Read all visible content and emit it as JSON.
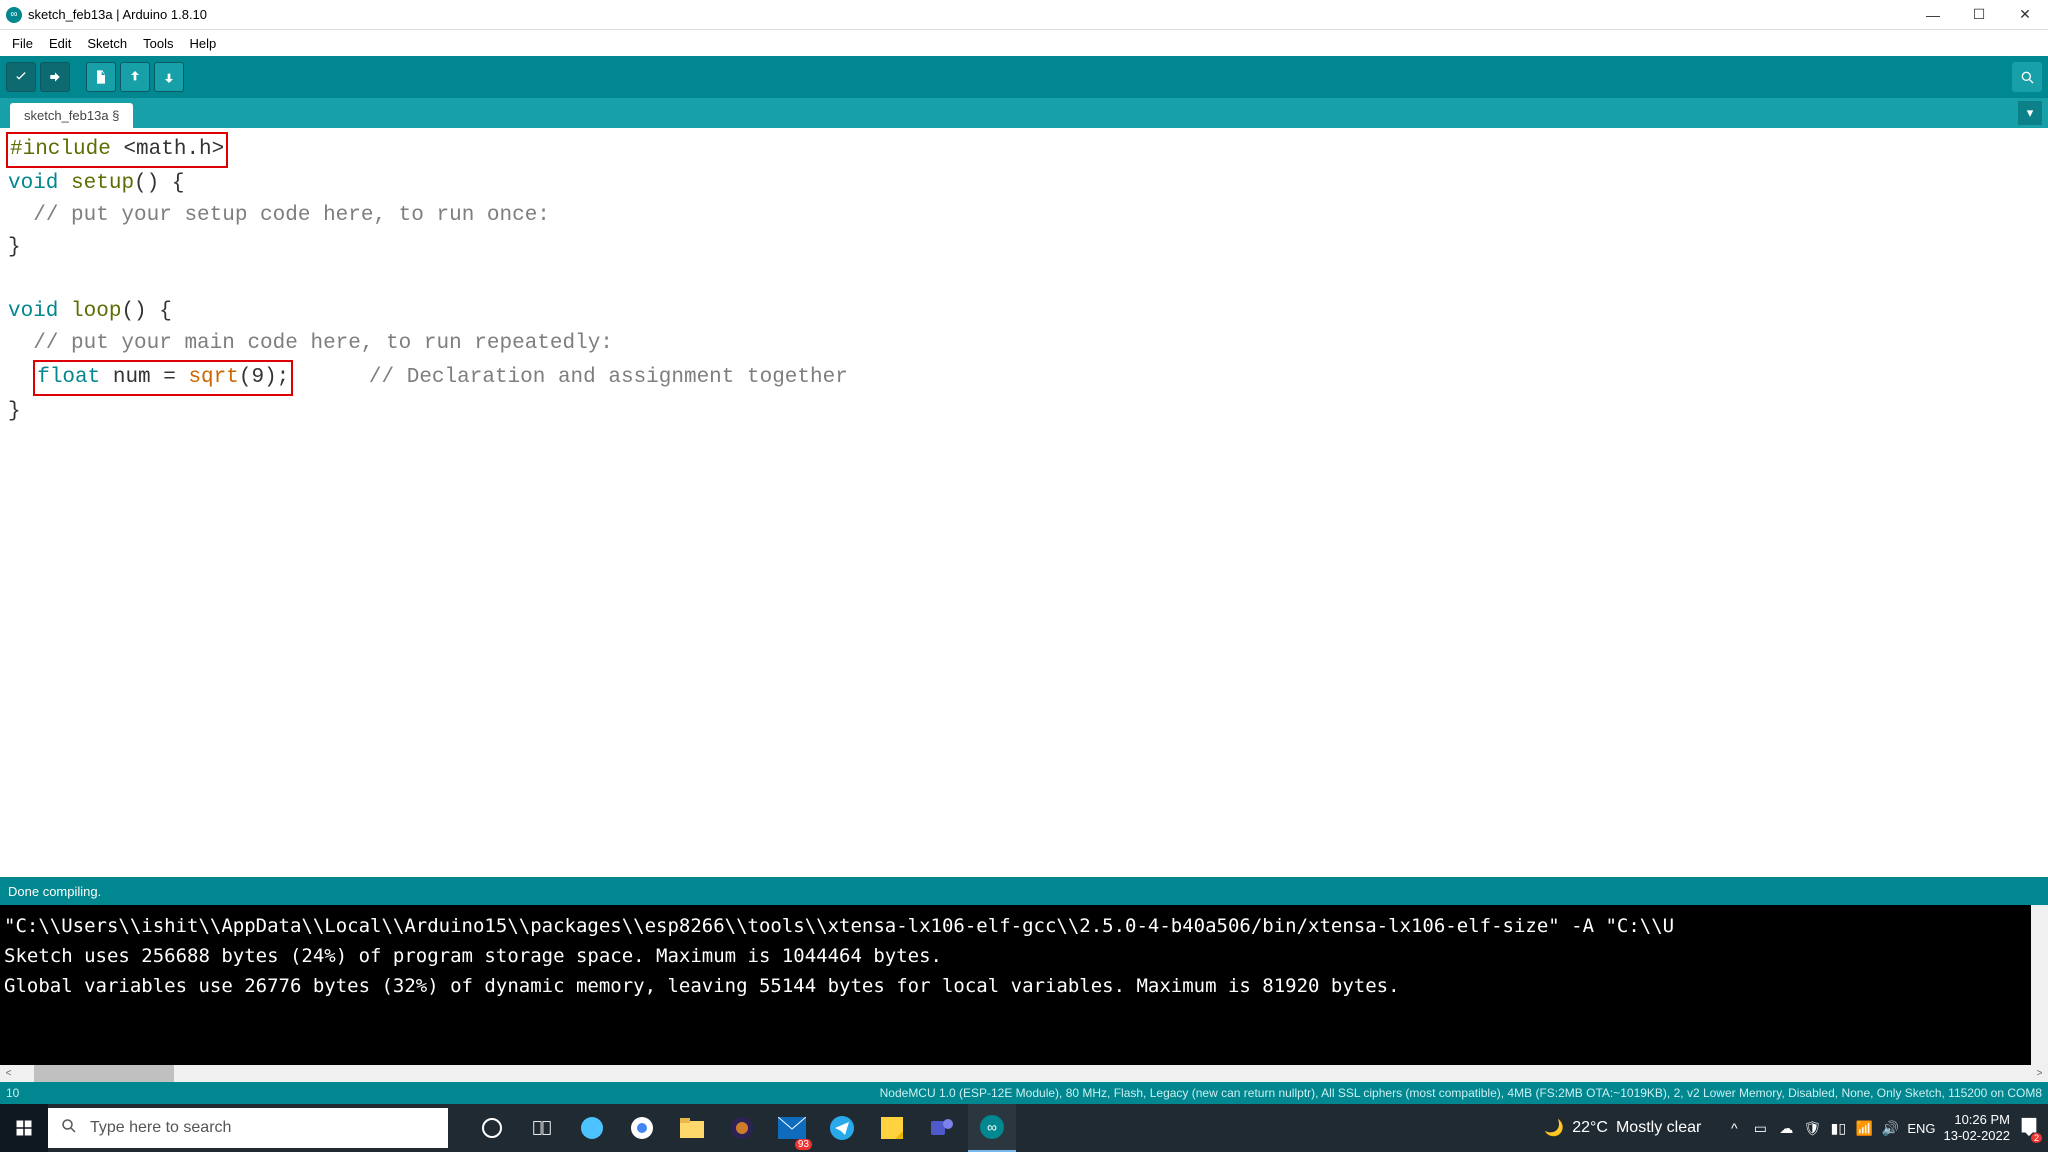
{
  "titlebar": {
    "title": "sketch_feb13a | Arduino 1.8.10"
  },
  "menu": {
    "file": "File",
    "edit": "Edit",
    "sketch": "Sketch",
    "tools": "Tools",
    "help": "Help"
  },
  "tab": {
    "name": "sketch_feb13a §"
  },
  "code": {
    "l1_include": "#include",
    "l1_header": "<math.h>",
    "l2_void": "void",
    "l2_setup": "setup",
    "l2_paren": "() {",
    "l3_cmt": "// put your setup code here, to run once:",
    "l4": "}",
    "l6_void": "void",
    "l6_loop": "loop",
    "l6_paren": "() {",
    "l7_cmt": "// put your main code here, to run repeatedly:",
    "l8_float": "float",
    "l8_var": " num = ",
    "l8_sqrt": "sqrt",
    "l8_arg": "(9);",
    "l8_cmt": "// Declaration and assignment together",
    "l9": "}"
  },
  "status": {
    "text": "Done compiling."
  },
  "console": {
    "l1": "\"C:\\\\Users\\\\ishit\\\\AppData\\\\Local\\\\Arduino15\\\\packages\\\\esp8266\\\\tools\\\\xtensa-lx106-elf-gcc\\\\2.5.0-4-b40a506/bin/xtensa-lx106-elf-size\" -A \"C:\\\\U",
    "l2": "Sketch uses 256688 bytes (24%) of program storage space. Maximum is 1044464 bytes.",
    "l3": "Global variables use 26776 bytes (32%) of dynamic memory, leaving 55144 bytes for local variables. Maximum is 81920 bytes."
  },
  "footer": {
    "line": "10",
    "board": "NodeMCU 1.0 (ESP-12E Module), 80 MHz, Flash, Legacy (new can return nullptr), All SSL ciphers (most compatible), 4MB (FS:2MB OTA:~1019KB), 2, v2 Lower Memory, Disabled, None, Only Sketch, 115200 on COM8"
  },
  "taskbar": {
    "search_placeholder": "Type here to search",
    "weather_temp": "22°C",
    "weather_desc": "Mostly clear",
    "lang": "ENG",
    "time": "10:26 PM",
    "date": "13-02-2022",
    "mail_badge": "93",
    "notif_badge": "2"
  }
}
